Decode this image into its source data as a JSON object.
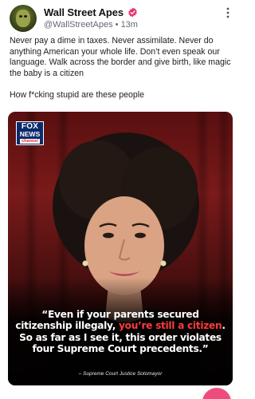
{
  "post": {
    "author_name": "Wall Street Apes",
    "author_handle": "@WallStreetApes",
    "separator": "•",
    "time_ago": "13m",
    "paragraph_1": "Never pay a dime in taxes. Never assimilate. Never do anything American your whole life. Don’t even speak our language. Walk across the border and give birth, like magic the baby is a citizen",
    "paragraph_2": "How f*cking stupid are these people"
  },
  "media": {
    "network_logo": {
      "line1": "FOX",
      "line2": "NEWS",
      "line3": "channel"
    },
    "quote_open": "“Even if your parents secured citizenship illegaly, ",
    "quote_highlight": "you’re still a citizen",
    "quote_close": ". So as far as I see it, this order violates four Supreme Court precedents.”",
    "attribution": "– Supreme Court Justice Sotomayor"
  },
  "colors": {
    "verified_badge": "#e8336f",
    "highlight": "#ff3a3a",
    "fab": "#ef4c7e"
  },
  "icons": {
    "verified": "verified-badge-icon",
    "more": "more-vertical-icon"
  }
}
